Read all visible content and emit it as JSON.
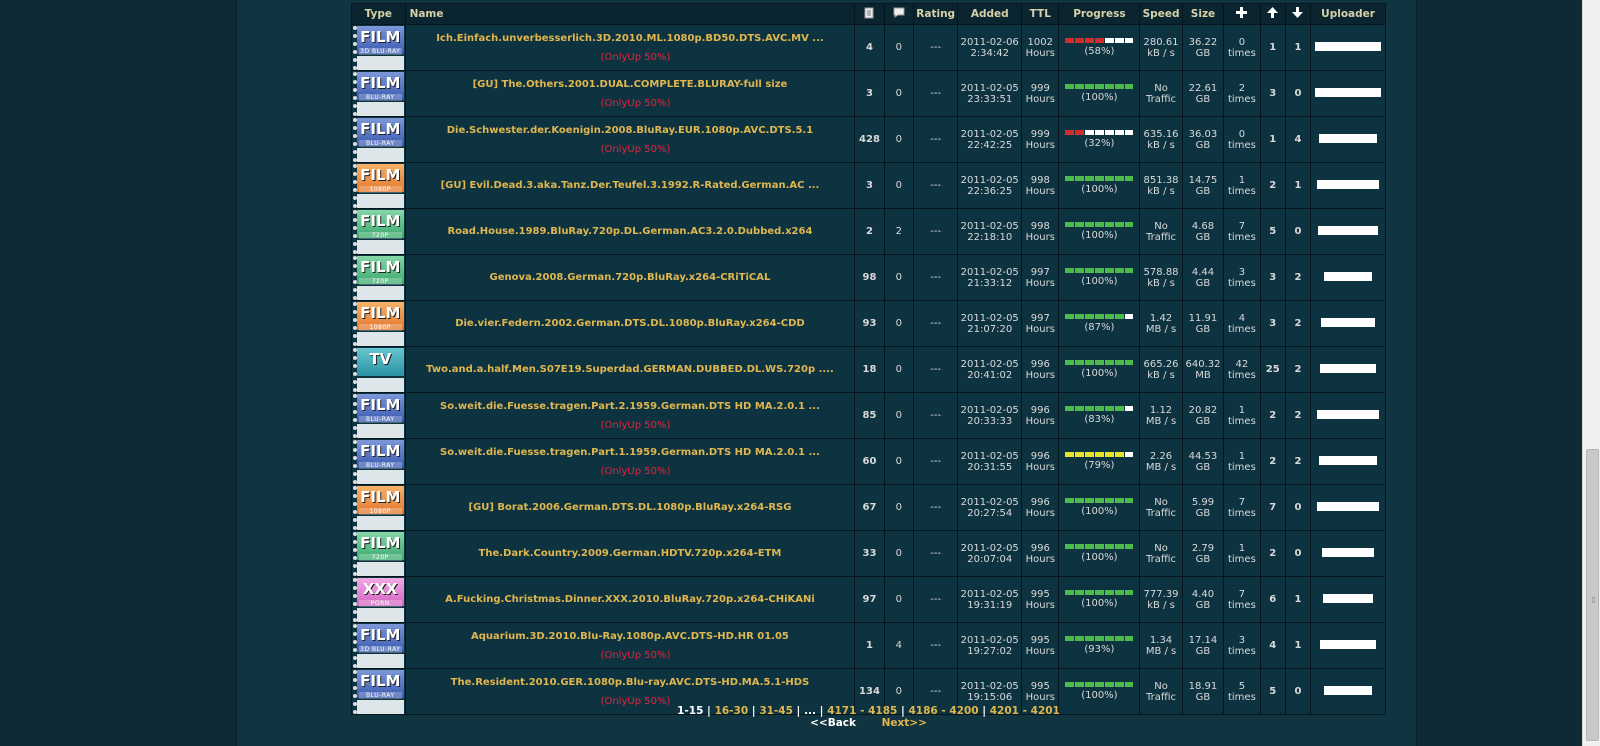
{
  "headers": [
    "Type",
    "Name",
    "",
    "",
    "Rating",
    "Added",
    "TTL",
    "Progress",
    "Speed",
    "Size",
    "",
    "",
    "",
    "Uploader"
  ],
  "header_icons": [
    "file-icon",
    "comment-icon",
    "",
    "",
    "",
    "",
    "",
    "",
    "",
    "",
    "plus-icon",
    "seeders-arrow-up-icon",
    "leechers-arrow-down-icon"
  ],
  "rows": [
    {
      "cat": {
        "word": "FILM",
        "sub": "3D BLU-RAY",
        "color": "blue"
      },
      "name": "Ich.Einfach.unverbesserlich.3D.2010.ML.1080p.BD50.DTS.AVC.MV ...",
      "onlyup": "(OnlyUp 50%)",
      "files": "4",
      "comments": "0",
      "rating": "---",
      "added_date": "2011-02-06",
      "added_time": "2:34:42",
      "ttl_num": "1002",
      "ttl_unit": "Hours",
      "progress": 58,
      "progress_label": "(58%)",
      "bar_color": "red",
      "speed1": "280.61",
      "speed2": "kB / s",
      "size1": "36.22",
      "size2": "GB",
      "times1": "0",
      "times2": "times",
      "times_color": "white",
      "seeders": "1",
      "seeders_color": "green",
      "leechers": "1",
      "uploader_w": 66
    },
    {
      "cat": {
        "word": "FILM",
        "sub": "BLU-RAY",
        "color": "blue"
      },
      "name": "[GU] The.Others.2001.DUAL.COMPLETE.BLURAY-full size",
      "onlyup": "(OnlyUp 50%)",
      "files": "3",
      "comments": "0",
      "rating": "---",
      "added_date": "2011-02-05",
      "added_time": "23:33:51",
      "ttl_num": "999",
      "ttl_unit": "Hours",
      "progress": 100,
      "progress_label": "(100%)",
      "bar_color": "green",
      "speed1": "No",
      "speed2": "Traffic",
      "size1": "22.61",
      "size2": "GB",
      "times1": "2",
      "times2": "times",
      "times_color": "gold",
      "seeders": "3",
      "seeders_color": "green",
      "leechers": "0",
      "uploader_w": 66
    },
    {
      "cat": {
        "word": "FILM",
        "sub": "BLU-RAY",
        "color": "blue"
      },
      "name": "Die.Schwester.der.Koenigin.2008.BluRay.EUR.1080p.AVC.DTS.5.1",
      "onlyup": "(OnlyUp 50%)",
      "files": "428",
      "comments": "0",
      "rating": "---",
      "added_date": "2011-02-05",
      "added_time": "22:42:25",
      "ttl_num": "999",
      "ttl_unit": "Hours",
      "progress": 32,
      "progress_label": "(32%)",
      "bar_color": "red",
      "speed1": "635.16",
      "speed2": "kB / s",
      "size1": "36.03",
      "size2": "GB",
      "times1": "0",
      "times2": "times",
      "times_color": "white",
      "seeders": "1",
      "seeders_color": "red",
      "leechers": "4",
      "uploader_w": 58
    },
    {
      "cat": {
        "word": "FILM",
        "sub": "1080P",
        "color": "orange"
      },
      "name": "[GU] Evil.Dead.3.aka.Tanz.Der.Teufel.3.1992.R-Rated.German.AC ...",
      "onlyup": "",
      "files": "3",
      "comments": "0",
      "rating": "---",
      "added_date": "2011-02-05",
      "added_time": "22:36:25",
      "ttl_num": "998",
      "ttl_unit": "Hours",
      "progress": 100,
      "progress_label": "(100%)",
      "bar_color": "green",
      "speed1": "851.38",
      "speed2": "kB / s",
      "size1": "14.75",
      "size2": "GB",
      "times1": "1",
      "times2": "times",
      "times_color": "gold",
      "seeders": "2",
      "seeders_color": "green",
      "leechers": "1",
      "uploader_w": 62
    },
    {
      "cat": {
        "word": "FILM",
        "sub": "720P",
        "color": "green"
      },
      "name": "Road.House.1989.BluRay.720p.DL.German.AC3.2.0.Dubbed.x264",
      "onlyup": "",
      "files": "2",
      "comments": "2",
      "rating": "---",
      "added_date": "2011-02-05",
      "added_time": "22:18:10",
      "ttl_num": "998",
      "ttl_unit": "Hours",
      "progress": 100,
      "progress_label": "(100%)",
      "bar_color": "green",
      "speed1": "No",
      "speed2": "Traffic",
      "size1": "4.68",
      "size2": "GB",
      "times1": "7",
      "times2": "times",
      "times_color": "gold",
      "seeders": "5",
      "seeders_color": "green",
      "leechers": "0",
      "uploader_w": 60
    },
    {
      "cat": {
        "word": "FILM",
        "sub": "720P",
        "color": "green"
      },
      "name": "Genova.2008.German.720p.BluRay.x264-CRiTiCAL",
      "onlyup": "",
      "files": "98",
      "comments": "0",
      "rating": "---",
      "added_date": "2011-02-05",
      "added_time": "21:33:12",
      "ttl_num": "997",
      "ttl_unit": "Hours",
      "progress": 100,
      "progress_label": "(100%)",
      "bar_color": "green",
      "speed1": "578.88",
      "speed2": "kB / s",
      "size1": "4.44",
      "size2": "GB",
      "times1": "3",
      "times2": "times",
      "times_color": "gold",
      "seeders": "3",
      "seeders_color": "green",
      "leechers": "2",
      "uploader_w": 48
    },
    {
      "cat": {
        "word": "FILM",
        "sub": "1080P",
        "color": "orange"
      },
      "name": "Die.vier.Federn.2002.German.DTS.DL.1080p.BluRay.x264-CDD",
      "onlyup": "",
      "files": "93",
      "comments": "0",
      "rating": "---",
      "added_date": "2011-02-05",
      "added_time": "21:07:20",
      "ttl_num": "997",
      "ttl_unit": "Hours",
      "progress": 87,
      "progress_label": "(87%)",
      "bar_color": "green",
      "speed1": "1.42",
      "speed2": "MB / s",
      "size1": "11.91",
      "size2": "GB",
      "times1": "4",
      "times2": "times",
      "times_color": "gold",
      "seeders": "3",
      "seeders_color": "green",
      "leechers": "2",
      "uploader_w": 54
    },
    {
      "cat": {
        "word": "TV",
        "sub": "",
        "color": "teal"
      },
      "name": "Two.and.a.half.Men.S07E19.Superdad.GERMAN.DUBBED.DL.WS.720p ....",
      "onlyup": "",
      "files": "18",
      "comments": "0",
      "rating": "---",
      "added_date": "2011-02-05",
      "added_time": "20:41:02",
      "ttl_num": "996",
      "ttl_unit": "Hours",
      "progress": 100,
      "progress_label": "(100%)",
      "bar_color": "green",
      "speed1": "665.26",
      "speed2": "kB / s",
      "size1": "640.32",
      "size2": "MB",
      "times1": "42",
      "times2": "times",
      "times_color": "gold",
      "seeders": "25",
      "seeders_color": "green",
      "leechers": "2",
      "uploader_w": 56
    },
    {
      "cat": {
        "word": "FILM",
        "sub": "BLU-RAY",
        "color": "blue"
      },
      "name": "So.weit.die.Fuesse.tragen.Part.2.1959.German.DTS HD MA.2.0.1 ...",
      "onlyup": "(OnlyUp 50%)",
      "files": "85",
      "comments": "0",
      "rating": "---",
      "added_date": "2011-02-05",
      "added_time": "20:33:33",
      "ttl_num": "996",
      "ttl_unit": "Hours",
      "progress": 83,
      "progress_label": "(83%)",
      "bar_color": "green",
      "speed1": "1.12",
      "speed2": "MB / s",
      "size1": "20.82",
      "size2": "GB",
      "times1": "1",
      "times2": "times",
      "times_color": "gold",
      "seeders": "2",
      "seeders_color": "green",
      "leechers": "2",
      "uploader_w": 62
    },
    {
      "cat": {
        "word": "FILM",
        "sub": "BLU-RAY",
        "color": "blue"
      },
      "name": "So.weit.die.Fuesse.tragen.Part.1.1959.German.DTS HD MA.2.0.1 ...",
      "onlyup": "(OnlyUp 50%)",
      "files": "60",
      "comments": "0",
      "rating": "---",
      "added_date": "2011-02-05",
      "added_time": "20:31:55",
      "ttl_num": "996",
      "ttl_unit": "Hours",
      "progress": 79,
      "progress_label": "(79%)",
      "bar_color": "yellow",
      "speed1": "2.26",
      "speed2": "MB / s",
      "size1": "44.53",
      "size2": "GB",
      "times1": "1",
      "times2": "times",
      "times_color": "gold",
      "seeders": "2",
      "seeders_color": "green",
      "leechers": "2",
      "uploader_w": 58
    },
    {
      "cat": {
        "word": "FILM",
        "sub": "1080P",
        "color": "orange"
      },
      "name": "[GU] Borat.2006.German.DTS.DL.1080p.BluRay.x264-RSG",
      "onlyup": "",
      "files": "67",
      "comments": "0",
      "rating": "---",
      "added_date": "2011-02-05",
      "added_time": "20:27:54",
      "ttl_num": "996",
      "ttl_unit": "Hours",
      "progress": 100,
      "progress_label": "(100%)",
      "bar_color": "green",
      "speed1": "No",
      "speed2": "Traffic",
      "size1": "5.99",
      "size2": "GB",
      "times1": "7",
      "times2": "times",
      "times_color": "gold",
      "seeders": "7",
      "seeders_color": "green",
      "leechers": "0",
      "uploader_w": 62
    },
    {
      "cat": {
        "word": "FILM",
        "sub": "720P",
        "color": "green"
      },
      "name": "The.Dark.Country.2009.German.HDTV.720p.x264-ETM",
      "onlyup": "",
      "files": "33",
      "comments": "0",
      "rating": "---",
      "added_date": "2011-02-05",
      "added_time": "20:07:04",
      "ttl_num": "996",
      "ttl_unit": "Hours",
      "progress": 100,
      "progress_label": "(100%)",
      "bar_color": "green",
      "speed1": "No",
      "speed2": "Traffic",
      "size1": "2.79",
      "size2": "GB",
      "times1": "1",
      "times2": "times",
      "times_color": "gold",
      "seeders": "2",
      "seeders_color": "green",
      "leechers": "0",
      "uploader_w": 52
    },
    {
      "cat": {
        "word": "XXX",
        "sub": "PORN",
        "color": "pink"
      },
      "name": "A.Fucking.Christmas.Dinner.XXX.2010.BluRay.720p.x264-CHiKANi",
      "onlyup": "",
      "files": "97",
      "comments": "0",
      "rating": "---",
      "added_date": "2011-02-05",
      "added_time": "19:31:19",
      "ttl_num": "995",
      "ttl_unit": "Hours",
      "progress": 100,
      "progress_label": "(100%)",
      "bar_color": "green",
      "speed1": "777.39",
      "speed2": "kB / s",
      "size1": "4.40",
      "size2": "GB",
      "times1": "7",
      "times2": "times",
      "times_color": "gold",
      "seeders": "6",
      "seeders_color": "green",
      "leechers": "1",
      "uploader_w": 50
    },
    {
      "cat": {
        "word": "FILM",
        "sub": "3D BLU-RAY",
        "color": "blue"
      },
      "name": "Aquarium.3D.2010.Blu-Ray.1080p.AVC.DTS-HD.HR 01.05",
      "onlyup": "(OnlyUp 50%)",
      "files": "1",
      "comments": "4",
      "rating": "---",
      "added_date": "2011-02-05",
      "added_time": "19:27:02",
      "ttl_num": "995",
      "ttl_unit": "Hours",
      "progress": 93,
      "progress_label": "(93%)",
      "bar_color": "green",
      "speed1": "1.34",
      "speed2": "MB / s",
      "size1": "17.14",
      "size2": "GB",
      "times1": "3",
      "times2": "times",
      "times_color": "gold",
      "seeders": "4",
      "seeders_color": "green",
      "leechers": "1",
      "uploader_w": 56
    },
    {
      "cat": {
        "word": "FILM",
        "sub": "BLU-RAY",
        "color": "blue"
      },
      "name": "The.Resident.2010.GER.1080p.Blu-ray.AVC.DTS-HD.MA.5.1-HDS",
      "onlyup": "(OnlyUp 50%)",
      "files": "134",
      "comments": "0",
      "rating": "---",
      "added_date": "2011-02-05",
      "added_time": "19:15:06",
      "ttl_num": "995",
      "ttl_unit": "Hours",
      "progress": 100,
      "progress_label": "(100%)",
      "bar_color": "green",
      "speed1": "No",
      "speed2": "Traffic",
      "size1": "18.91",
      "size2": "GB",
      "times1": "5",
      "times2": "times",
      "times_color": "gold",
      "seeders": "5",
      "seeders_color": "green",
      "leechers": "0",
      "uploader_w": 48
    }
  ],
  "pagination": {
    "current": "1-15",
    "pages": [
      "16-30",
      "31-45",
      "...",
      "4171 - 4185",
      "4186 - 4200",
      "4201 - 4201"
    ],
    "back": "<<Back",
    "next": "Next>>"
  },
  "colors": {
    "gold": "#e0b64e",
    "green": "#3fc45b",
    "red": "#d02020",
    "yellow": "#e6e32a",
    "bar_green": "#4cbb4c",
    "bar_red": "#d42b2b",
    "onlyup": "#e5233a"
  }
}
